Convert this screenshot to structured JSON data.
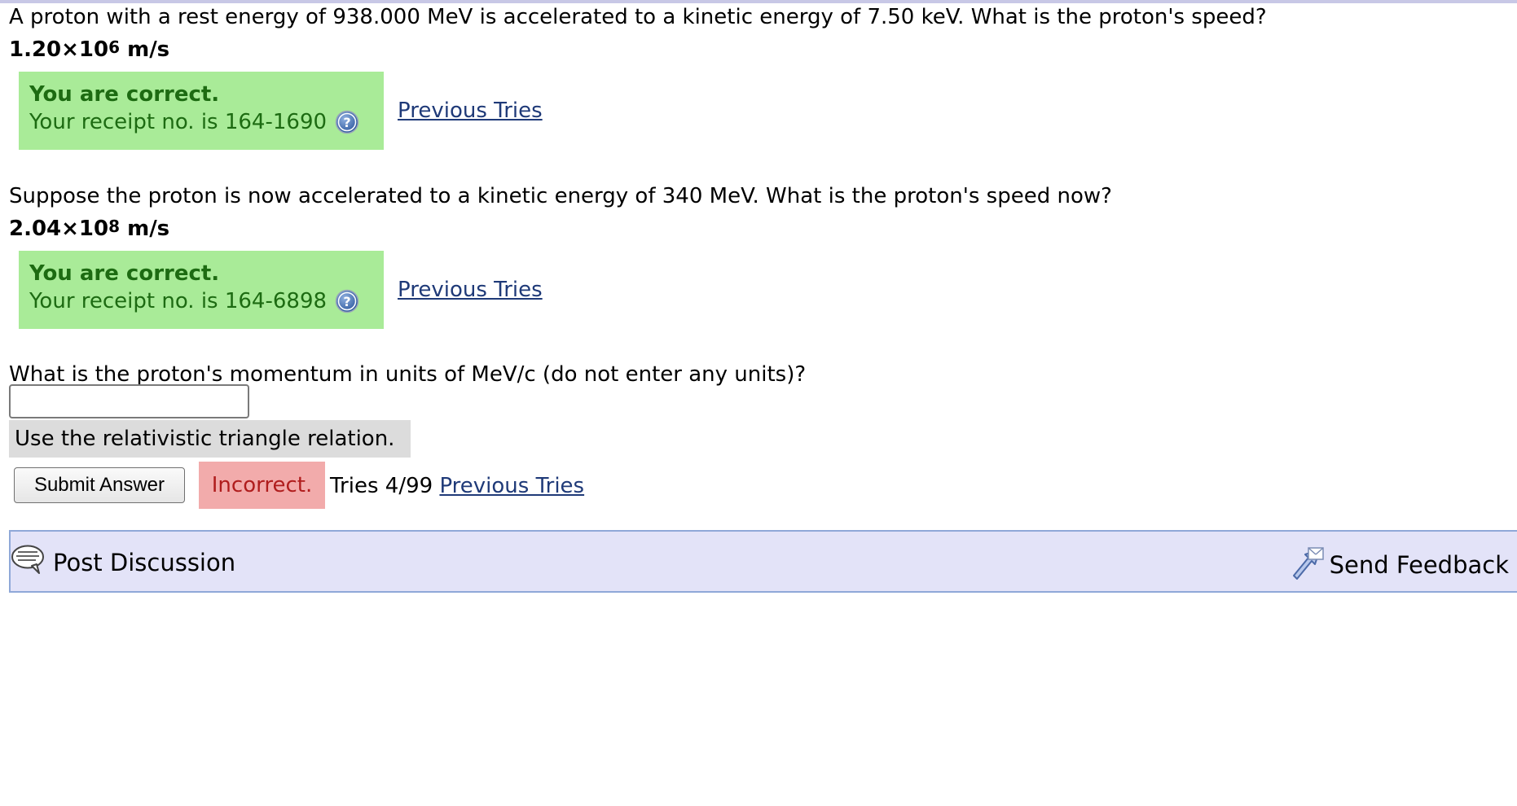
{
  "question1": {
    "text": "A proton with a rest energy of 938.000 MeV is accelerated to a kinetic energy of 7.50 keV. What is the proton's speed?",
    "answer_mantissa": "1.20×10",
    "answer_exponent": "6",
    "answer_unit": " m/s",
    "status_title": "You are correct.",
    "receipt": "Your receipt no. is 164-1690",
    "previous_tries_label": "Previous Tries"
  },
  "question2": {
    "text": "Suppose the proton is now accelerated to a kinetic energy of 340 MeV. What is the proton's speed now?",
    "answer_mantissa": "2.04×10",
    "answer_exponent": "8",
    "answer_unit": " m/s",
    "status_title": "You are correct.",
    "receipt": "Your receipt no. is 164-6898",
    "previous_tries_label": "Previous Tries"
  },
  "question3": {
    "text": "What is the proton's momentum in units of MeV/c (do not enter any units)?",
    "input_value": "",
    "hint": "Use the relativistic triangle relation.",
    "submit_label": "Submit Answer",
    "status": "Incorrect.",
    "tries": "Tries 4/99",
    "previous_tries_label": "Previous Tries"
  },
  "footer": {
    "post_discussion_label": "Post Discussion",
    "send_feedback_label": "Send Feedback"
  },
  "icons": {
    "help": "help-icon",
    "discussion": "speech-bubble-icon",
    "feedback": "feedback-arrow-icon"
  },
  "colors": {
    "correct_bg": "#a9eb98",
    "correct_text": "#1d6b12",
    "incorrect_bg": "#f2abab",
    "incorrect_text": "#b01d1d",
    "link": "#1f3a78",
    "footer_bg": "#e3e3f8",
    "footer_border": "#8fa8d8"
  }
}
